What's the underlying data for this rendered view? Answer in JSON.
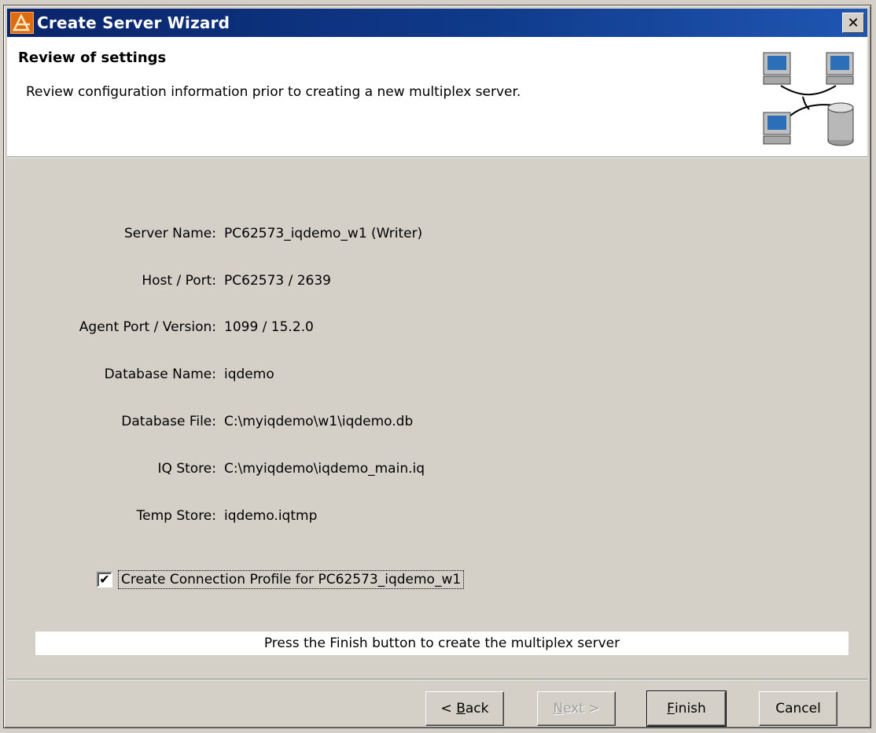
{
  "window": {
    "title": "Create Server Wizard",
    "close_glyph": "✕"
  },
  "header": {
    "title": "Review of settings",
    "description": "Review configuration information prior to creating a new multiplex server.",
    "art_icon": "network-computers-database-icon"
  },
  "fields": [
    {
      "label": "Server Name:",
      "value": "PC62573_iqdemo_w1 (Writer)"
    },
    {
      "label": "Host / Port:",
      "value": "PC62573 / 2639"
    },
    {
      "label": "Agent Port / Version:",
      "value": "1099 / 15.2.0"
    },
    {
      "label": "Database Name:",
      "value": "iqdemo"
    },
    {
      "label": "Database File:",
      "value": "C:\\myiqdemo\\w1\\iqdemo.db"
    },
    {
      "label": "IQ Store:",
      "value": "C:\\myiqdemo\\iqdemo_main.iq"
    },
    {
      "label": "Temp Store:",
      "value": "iqdemo.iqtmp"
    }
  ],
  "checkbox": {
    "label": "Create Connection Profile for PC62573_iqdemo_w1",
    "checked": true,
    "check_glyph": "✔"
  },
  "instruction": "Press the Finish button to create the multiplex server",
  "buttons": {
    "back": {
      "prefix": "< ",
      "mnemonic": "B",
      "rest": "ack"
    },
    "next": {
      "mnemonic": "N",
      "rest": "ext >"
    },
    "finish": {
      "mnemonic": "F",
      "rest": "inish"
    },
    "cancel": "Cancel"
  },
  "colors": {
    "titlebar": "#0a246a",
    "face": "#d4d0c8",
    "app_icon": "#e06a10"
  }
}
